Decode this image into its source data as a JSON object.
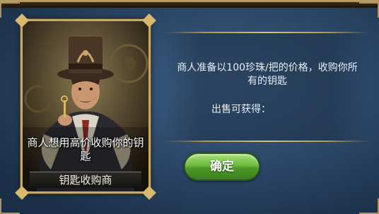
{
  "card": {
    "caption": "商人想用高价收购你的钥匙",
    "name": "钥匙收购商"
  },
  "info": {
    "description": "商人准备以100珍珠/把的价格，收购你所有的钥匙",
    "sell_label": "出售可获得："
  },
  "confirm_button": {
    "label": "确定"
  },
  "colors": {
    "gold_border": "#c9a863",
    "panel_blue": "#2b4767",
    "button_green": "#6dbb3f"
  }
}
